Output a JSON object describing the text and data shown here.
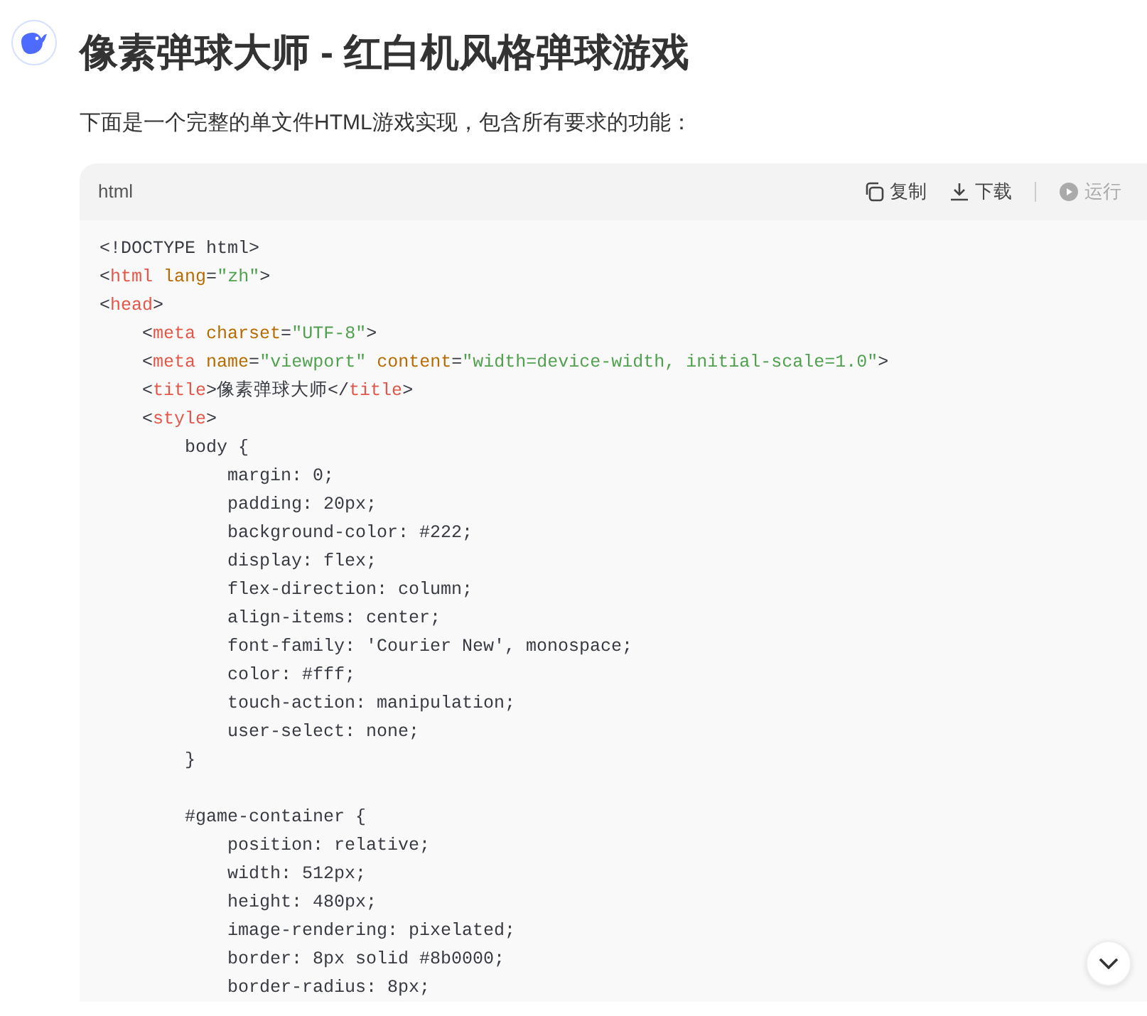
{
  "title": "像素弹球大师 - 红白机风格弹球游戏",
  "intro": "下面是一个完整的单文件HTML游戏实现，包含所有要求的功能：",
  "code_block": {
    "language": "html",
    "actions": [
      {
        "kind": "copy",
        "label": "复制",
        "disabled": false
      },
      {
        "kind": "download",
        "label": "下载",
        "disabled": false
      },
      {
        "kind": "run",
        "label": "运行",
        "disabled": true
      }
    ],
    "lines": [
      {
        "kind": "code",
        "tokens": [
          {
            "kind": "plain",
            "text": "<!DOCTYPE html>"
          }
        ]
      },
      {
        "kind": "code",
        "tokens": [
          {
            "kind": "plain",
            "text": "<"
          },
          {
            "kind": "tag",
            "text": "html"
          },
          {
            "kind": "attr",
            "text": " lang"
          },
          {
            "kind": "plain",
            "text": "="
          },
          {
            "kind": "string",
            "text": "\"zh\""
          },
          {
            "kind": "plain",
            "text": ">"
          }
        ]
      },
      {
        "kind": "code",
        "tokens": [
          {
            "kind": "plain",
            "text": "<"
          },
          {
            "kind": "tag",
            "text": "head"
          },
          {
            "kind": "plain",
            "text": ">"
          }
        ]
      },
      {
        "kind": "code",
        "tokens": [
          {
            "kind": "plain",
            "text": "    <"
          },
          {
            "kind": "tag",
            "text": "meta"
          },
          {
            "kind": "attr",
            "text": " charset"
          },
          {
            "kind": "plain",
            "text": "="
          },
          {
            "kind": "string",
            "text": "\"UTF-8\""
          },
          {
            "kind": "plain",
            "text": ">"
          }
        ]
      },
      {
        "kind": "code",
        "tokens": [
          {
            "kind": "plain",
            "text": "    <"
          },
          {
            "kind": "tag",
            "text": "meta"
          },
          {
            "kind": "attr",
            "text": " name"
          },
          {
            "kind": "plain",
            "text": "="
          },
          {
            "kind": "string",
            "text": "\"viewport\""
          },
          {
            "kind": "attr",
            "text": " content"
          },
          {
            "kind": "plain",
            "text": "="
          },
          {
            "kind": "string",
            "text": "\"width=device-width, initial-scale=1.0\""
          },
          {
            "kind": "plain",
            "text": ">"
          }
        ]
      },
      {
        "kind": "code",
        "tokens": [
          {
            "kind": "plain",
            "text": "    <"
          },
          {
            "kind": "tag",
            "text": "title"
          },
          {
            "kind": "plain",
            "text": ">像素弹球大师</"
          },
          {
            "kind": "tag",
            "text": "title"
          },
          {
            "kind": "plain",
            "text": ">"
          }
        ]
      },
      {
        "kind": "code",
        "tokens": [
          {
            "kind": "plain",
            "text": "    <"
          },
          {
            "kind": "tag",
            "text": "style"
          },
          {
            "kind": "plain",
            "text": ">"
          }
        ]
      },
      {
        "kind": "code",
        "tokens": [
          {
            "kind": "plain",
            "text": "        body {"
          }
        ]
      },
      {
        "kind": "code",
        "tokens": [
          {
            "kind": "plain",
            "text": "            margin: 0;"
          }
        ]
      },
      {
        "kind": "code",
        "tokens": [
          {
            "kind": "plain",
            "text": "            padding: 20px;"
          }
        ]
      },
      {
        "kind": "code",
        "tokens": [
          {
            "kind": "plain",
            "text": "            background-color: #222;"
          }
        ]
      },
      {
        "kind": "code",
        "tokens": [
          {
            "kind": "plain",
            "text": "            display: flex;"
          }
        ]
      },
      {
        "kind": "code",
        "tokens": [
          {
            "kind": "plain",
            "text": "            flex-direction: column;"
          }
        ]
      },
      {
        "kind": "code",
        "tokens": [
          {
            "kind": "plain",
            "text": "            align-items: center;"
          }
        ]
      },
      {
        "kind": "code",
        "tokens": [
          {
            "kind": "plain",
            "text": "            font-family: 'Courier New', monospace;"
          }
        ]
      },
      {
        "kind": "code",
        "tokens": [
          {
            "kind": "plain",
            "text": "            color: #fff;"
          }
        ]
      },
      {
        "kind": "code",
        "tokens": [
          {
            "kind": "plain",
            "text": "            touch-action: manipulation;"
          }
        ]
      },
      {
        "kind": "code",
        "tokens": [
          {
            "kind": "plain",
            "text": "            user-select: none;"
          }
        ]
      },
      {
        "kind": "code",
        "tokens": [
          {
            "kind": "plain",
            "text": "        }"
          }
        ]
      },
      {
        "kind": "blank"
      },
      {
        "kind": "code",
        "tokens": [
          {
            "kind": "plain",
            "text": "        #game-container {"
          }
        ]
      },
      {
        "kind": "code",
        "tokens": [
          {
            "kind": "plain",
            "text": "            position: relative;"
          }
        ]
      },
      {
        "kind": "code",
        "tokens": [
          {
            "kind": "plain",
            "text": "            width: 512px;"
          }
        ]
      },
      {
        "kind": "code",
        "tokens": [
          {
            "kind": "plain",
            "text": "            height: 480px;"
          }
        ]
      },
      {
        "kind": "code",
        "tokens": [
          {
            "kind": "plain",
            "text": "            image-rendering: pixelated;"
          }
        ]
      },
      {
        "kind": "code",
        "tokens": [
          {
            "kind": "plain",
            "text": "            border: 8px solid #8b0000;"
          }
        ]
      },
      {
        "kind": "code",
        "tokens": [
          {
            "kind": "plain",
            "text": "            border-radius: 8px;"
          }
        ]
      }
    ]
  }
}
